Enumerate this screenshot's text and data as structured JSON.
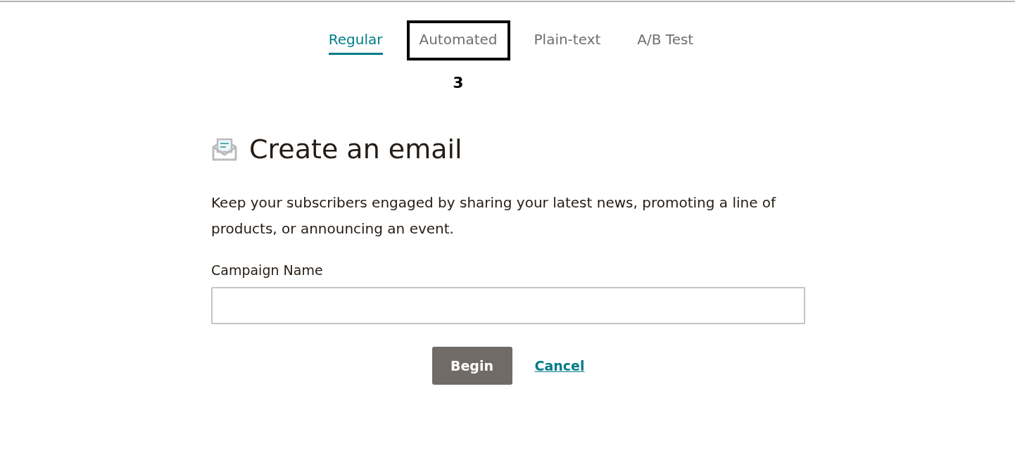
{
  "tabs": [
    {
      "label": "Regular",
      "selected": true,
      "highlighted": false
    },
    {
      "label": "Automated",
      "selected": false,
      "highlighted": true
    },
    {
      "label": "Plain-text",
      "selected": false,
      "highlighted": false
    },
    {
      "label": "A/B Test",
      "selected": false,
      "highlighted": false
    }
  ],
  "callout": "3",
  "heading": "Create an email",
  "description": "Keep your subscribers engaged by sharing your latest news, promoting a line of products, or announcing an event.",
  "field": {
    "label": "Campaign Name"
  },
  "buttons": {
    "primary": "Begin",
    "link": "Cancel"
  }
}
